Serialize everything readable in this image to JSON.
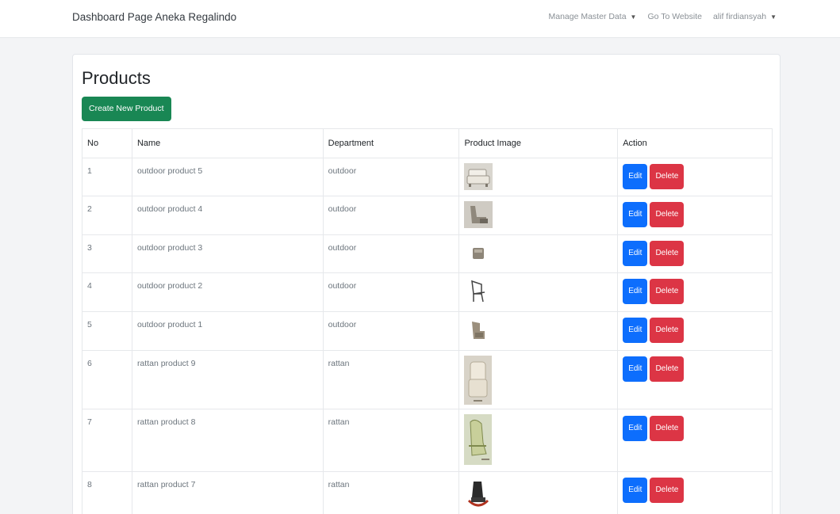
{
  "navbar": {
    "brand": "Dashboard Page Aneka Regalindo",
    "manage_master_data": "Manage Master Data",
    "go_to_website": "Go To Website",
    "user": "alif firdiansyah"
  },
  "page": {
    "title": "Products",
    "create_button": "Create New Product"
  },
  "table": {
    "headers": [
      "No",
      "Name",
      "Department",
      "Product Image",
      "Action"
    ],
    "edit_label": "Edit",
    "delete_label": "Delete",
    "rows": [
      {
        "no": "1",
        "name": "outdoor product 5",
        "department": "outdoor",
        "image": "sofa-icon"
      },
      {
        "no": "2",
        "name": "outdoor product 4",
        "department": "outdoor",
        "image": "lounge-chair-icon"
      },
      {
        "no": "3",
        "name": "outdoor product 3",
        "department": "outdoor",
        "image": "stool-icon"
      },
      {
        "no": "4",
        "name": "outdoor product 2",
        "department": "outdoor",
        "image": "chair-icon"
      },
      {
        "no": "5",
        "name": "outdoor product 1",
        "department": "outdoor",
        "image": "armchair-icon"
      },
      {
        "no": "6",
        "name": "rattan product 9",
        "department": "rattan",
        "image": "rattan-chair-icon"
      },
      {
        "no": "7",
        "name": "rattan product 8",
        "department": "rattan",
        "image": "rattan-lounge-icon"
      },
      {
        "no": "8",
        "name": "rattan product 7",
        "department": "rattan",
        "image": "rattan-rocker-icon"
      }
    ]
  },
  "colors": {
    "success": "#198754",
    "primary": "#0d6efd",
    "danger": "#dc3545"
  }
}
